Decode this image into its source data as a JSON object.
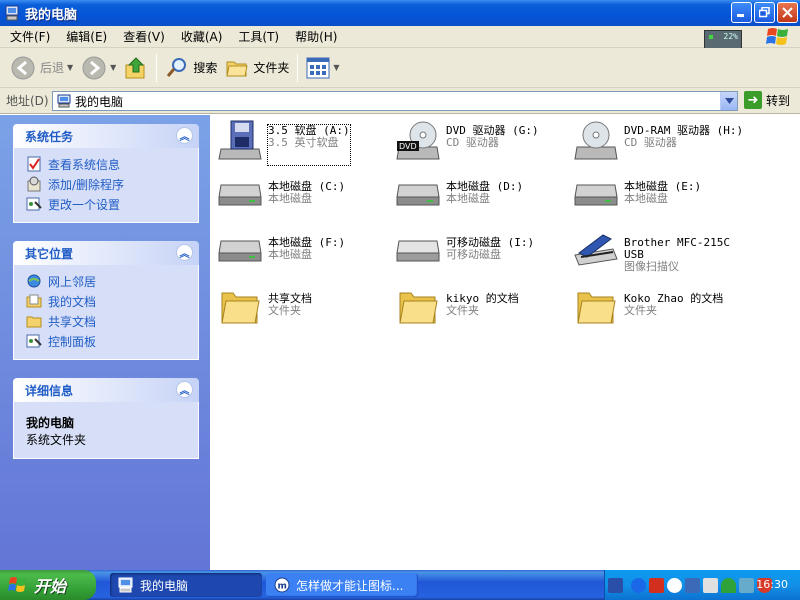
{
  "window": {
    "title": "我的电脑"
  },
  "menu": [
    "文件(F)",
    "编辑(E)",
    "查看(V)",
    "收藏(A)",
    "工具(T)",
    "帮助(H)"
  ],
  "throbber": {
    "pct": "22%"
  },
  "toolbar": {
    "back": "后退",
    "search": "搜索",
    "folders": "文件夹"
  },
  "address": {
    "label": "地址(D)",
    "value": "我的电脑",
    "go": "转到"
  },
  "panels": {
    "system_tasks": {
      "title": "系统任务",
      "items": [
        "查看系统信息",
        "添加/删除程序",
        "更改一个设置"
      ]
    },
    "other_places": {
      "title": "其它位置",
      "items": [
        "网上邻居",
        "我的文档",
        "共享文档",
        "控制面板"
      ]
    },
    "details": {
      "title": "详细信息",
      "name": "我的电脑",
      "type": "系统文件夹"
    }
  },
  "items": [
    {
      "name": "3.5 软盘 (A:)",
      "sub": "3.5 英寸软盘",
      "icon": "floppy-drive-icon"
    },
    {
      "name": "DVD 驱动器 (G:)",
      "sub": "CD 驱动器",
      "icon": "dvd-drive-icon"
    },
    {
      "name": "DVD-RAM 驱动器 (H:)",
      "sub": "CD 驱动器",
      "icon": "dvd-ram-drive-icon"
    },
    {
      "name": "本地磁盘 (C:)",
      "sub": "本地磁盘",
      "icon": "hard-disk-icon"
    },
    {
      "name": "本地磁盘 (D:)",
      "sub": "本地磁盘",
      "icon": "hard-disk-icon"
    },
    {
      "name": "本地磁盘 (E:)",
      "sub": "本地磁盘",
      "icon": "hard-disk-icon"
    },
    {
      "name": "本地磁盘 (F:)",
      "sub": "本地磁盘",
      "icon": "hard-disk-icon"
    },
    {
      "name": "可移动磁盘 (I:)",
      "sub": "可移动磁盘",
      "icon": "removable-disk-icon"
    },
    {
      "name": "Brother MFC-215C\nUSB",
      "sub": "图像扫描仪",
      "icon": "scanner-icon"
    },
    {
      "name": "共享文档",
      "sub": "文件夹",
      "icon": "folder-icon"
    },
    {
      "name": "kikyo 的文档",
      "sub": "文件夹",
      "icon": "folder-icon"
    },
    {
      "name": "Koko Zhao 的文档",
      "sub": "文件夹",
      "icon": "folder-icon"
    }
  ],
  "taskbar": {
    "start": "开始",
    "tasks": [
      "我的电脑",
      "怎样做才能让图标..."
    ],
    "clock": "16:30"
  },
  "colors": {
    "title_bar": "#0554d8",
    "taskbar": "#2157d7",
    "start_button": "#36a33a",
    "left_pane": "#7ba2e7"
  }
}
